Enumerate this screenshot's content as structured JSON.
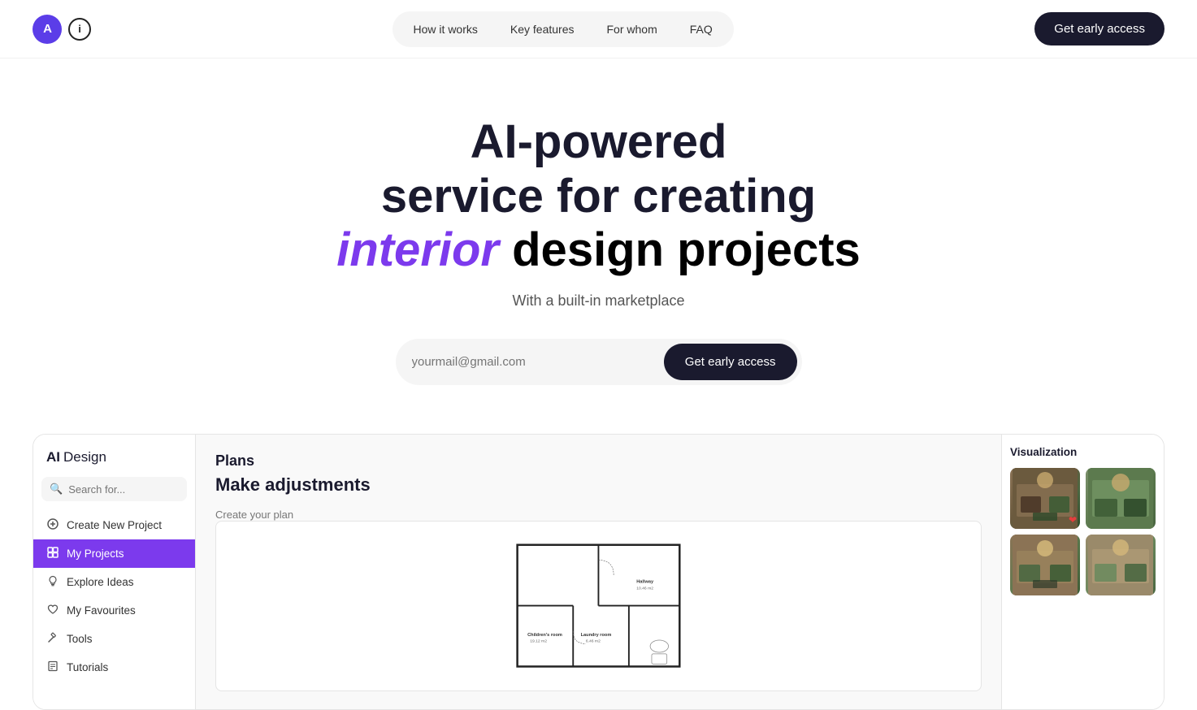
{
  "nav": {
    "logo_text_a": "A",
    "logo_icon": "ⓘ",
    "links": [
      {
        "label": "How it works",
        "id": "how-it-works"
      },
      {
        "label": "Key features",
        "id": "key-features"
      },
      {
        "label": "For whom",
        "id": "for-whom"
      },
      {
        "label": "FAQ",
        "id": "faq"
      }
    ],
    "cta_label": "Get early access"
  },
  "hero": {
    "title_line1": "AI-powered",
    "title_line2": "service for creating",
    "title_line3_prefix": "interior",
    "title_line3_suffix": " design projects",
    "subtitle": "With a built-in marketplace",
    "input_placeholder": "yourmail@gmail.com",
    "cta_label": "Get early access"
  },
  "sidebar": {
    "logo_ai": "AI",
    "logo_design": "Design",
    "search_placeholder": "Search for...",
    "items": [
      {
        "id": "create-new-project",
        "label": "Create New Project",
        "icon": "⊕"
      },
      {
        "id": "my-projects",
        "label": "My Projects",
        "icon": "⧉",
        "active": true
      },
      {
        "id": "explore-ideas",
        "label": "Explore Ideas",
        "icon": "💡"
      },
      {
        "id": "my-favourites",
        "label": "My Favourites",
        "icon": "♡"
      },
      {
        "id": "tools",
        "label": "Tools",
        "icon": "✏"
      },
      {
        "id": "tutorials",
        "label": "Tutorials",
        "icon": "📖"
      }
    ]
  },
  "main": {
    "section_title": "Plans",
    "content_title": "Make adjustments",
    "content_subtitle": "Create your plan"
  },
  "visualization": {
    "title": "Visualization",
    "thumbs": [
      {
        "id": "thumb-1",
        "has_heart": true
      },
      {
        "id": "thumb-2",
        "has_heart": false
      },
      {
        "id": "thumb-3",
        "has_heart": false
      },
      {
        "id": "thumb-4",
        "has_heart": false
      }
    ]
  }
}
